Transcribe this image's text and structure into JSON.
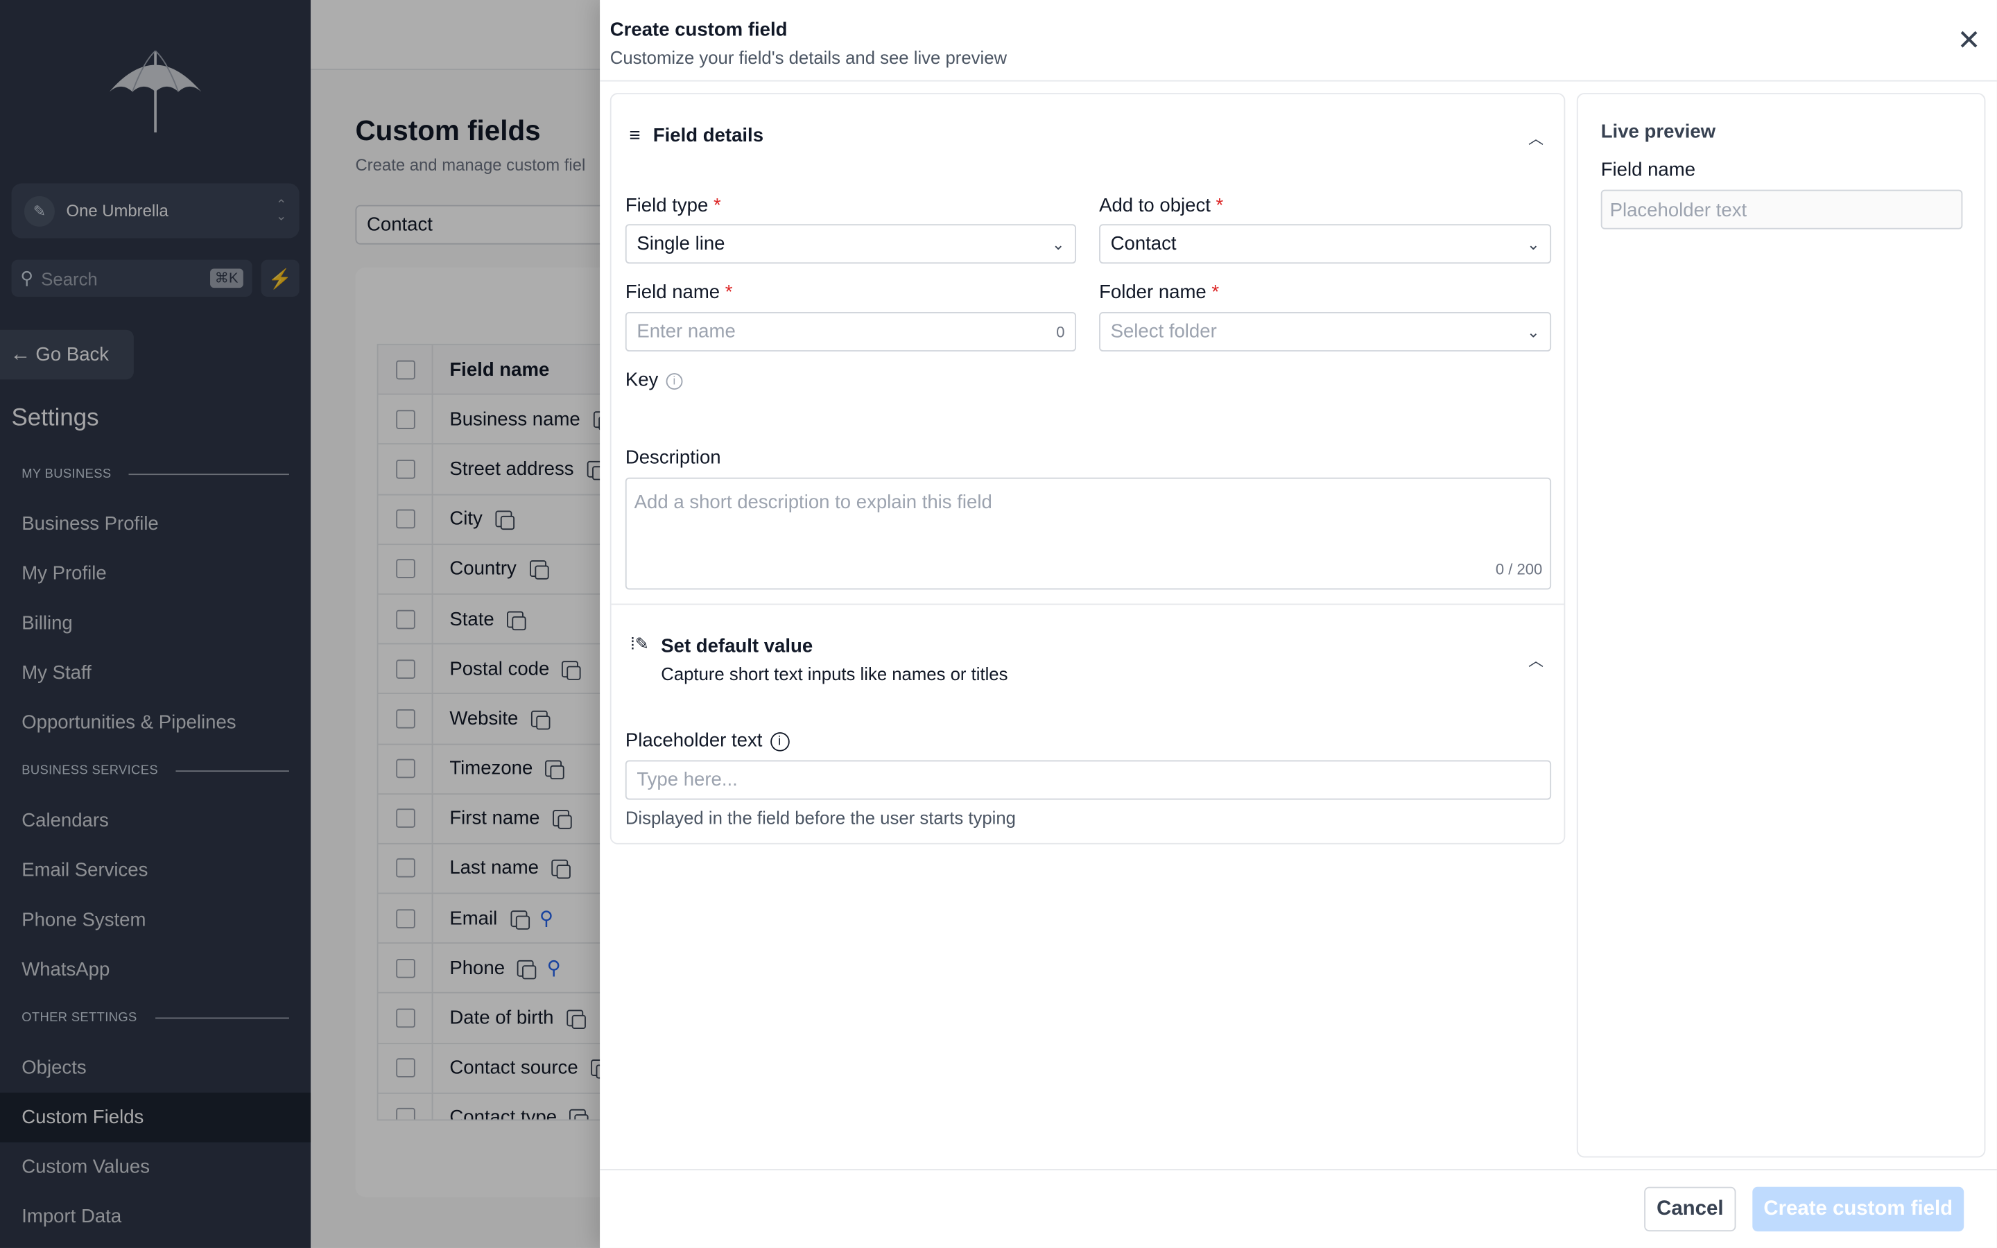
{
  "sidebar": {
    "location_name": "One Umbrella",
    "search_placeholder": "Search",
    "search_shortcut": "⌘K",
    "go_back": "Go Back",
    "settings_title": "Settings",
    "sections": {
      "my_business": "MY BUSINESS",
      "business_services": "BUSINESS SERVICES",
      "other_settings": "OTHER SETTINGS"
    },
    "items": {
      "business_profile": "Business Profile",
      "my_profile": "My Profile",
      "billing": "Billing",
      "my_staff": "My Staff",
      "opportunities": "Opportunities & Pipelines",
      "calendars": "Calendars",
      "email_services": "Email Services",
      "phone_system": "Phone System",
      "whatsapp": "WhatsApp",
      "objects": "Objects",
      "custom_fields": "Custom Fields",
      "custom_values": "Custom Values",
      "import_data": "Import Data"
    },
    "active_item": "Custom Fields"
  },
  "page": {
    "title": "Custom fields",
    "subtitle": "Create and manage custom fiel",
    "object_selected": "Contact",
    "table_header": "Field name",
    "rows": [
      "Business name",
      "Street address",
      "City",
      "Country",
      "State",
      "Postal code",
      "Website",
      "Timezone",
      "First name",
      "Last name",
      "Email",
      "Phone",
      "Date of birth",
      "Contact source",
      "Contact type"
    ]
  },
  "drawer": {
    "title": "Create custom field",
    "subtitle": "Customize your field's details and see live preview",
    "field_details": {
      "heading": "Field details",
      "field_type_label": "Field type",
      "field_type_value": "Single line",
      "add_to_object_label": "Add to object",
      "add_to_object_value": "Contact",
      "field_name_label": "Field name",
      "field_name_placeholder": "Enter name",
      "field_name_count": "0",
      "folder_name_label": "Folder name",
      "folder_name_placeholder": "Select folder",
      "key_label": "Key",
      "description_label": "Description",
      "description_placeholder": "Add a short description to explain this field",
      "description_count": "0 / 200",
      "required_mark": "*"
    },
    "default_value": {
      "heading": "Set default value",
      "subheading": "Capture short text inputs like names or titles",
      "placeholder_label": "Placeholder text",
      "placeholder_input": "Type here...",
      "help_text": "Displayed in the field before the user starts typing"
    },
    "preview": {
      "heading": "Live preview",
      "field_label": "Field name",
      "field_placeholder": "Placeholder text"
    },
    "buttons": {
      "cancel": "Cancel",
      "create": "Create custom field"
    }
  },
  "colors": {
    "sidebar_bg": "#2e3647",
    "primary_disabled": "#bfdbfe",
    "required": "#dc2626",
    "search_accent": "#2563eb"
  }
}
